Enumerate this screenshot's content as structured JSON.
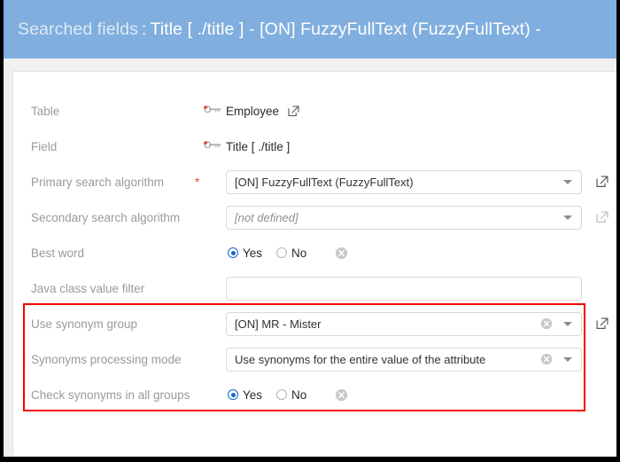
{
  "window": {
    "header": {
      "prefix": "Searched fields",
      "separator": ":",
      "title": "Title [ ./title ] - [ON] FuzzyFullText (FuzzyFullText) -"
    }
  },
  "form": {
    "rows": [
      {
        "label": "Table",
        "type": "static",
        "icon": "primary-key-icon",
        "value": "Employee",
        "has_external_link": true
      },
      {
        "label": "Field",
        "type": "static",
        "icon": "primary-key-icon",
        "value": "Title [ ./title ]",
        "has_external_link": false
      },
      {
        "label": "Primary search algorithm",
        "type": "select",
        "required": true,
        "value": "[ON] FuzzyFullText (FuzzyFullText)",
        "has_clear": false,
        "external_link": "enabled"
      },
      {
        "label": "Secondary search algorithm",
        "type": "select",
        "required": false,
        "value": "[not defined]",
        "value_is_placeholder": true,
        "has_clear": false,
        "external_link": "disabled"
      },
      {
        "label": "Best word",
        "type": "radio",
        "options": [
          "Yes",
          "No"
        ],
        "selected": "Yes",
        "has_clear": true
      },
      {
        "label": "Java class value filter",
        "type": "text",
        "value": "",
        "placeholder": ""
      },
      {
        "label": "Use synonym group",
        "type": "select",
        "value": "[ON] MR - Mister",
        "has_clear": true,
        "external_link": "enabled",
        "highlighted": true
      },
      {
        "label": "Synonyms processing mode",
        "type": "select",
        "value": "Use synonyms for the entire value of the attribute",
        "has_clear": true,
        "external_link": "none",
        "highlighted": true
      },
      {
        "label": "Check synonyms in all groups",
        "type": "radio",
        "options": [
          "Yes",
          "No"
        ],
        "selected": "Yes",
        "has_clear": true,
        "highlighted": true
      }
    ],
    "required_marker": "*"
  },
  "colors": {
    "header_background": "#80aede",
    "header_text": "#ffffff",
    "label_text": "#9a9a9a",
    "value_text": "#2b2b2b",
    "required_marker": "#e8443a",
    "radio_selected": "#1669c7",
    "highlight_border": "#f50000",
    "card_background": "#ffffff",
    "page_background": "#f1f1f1"
  }
}
